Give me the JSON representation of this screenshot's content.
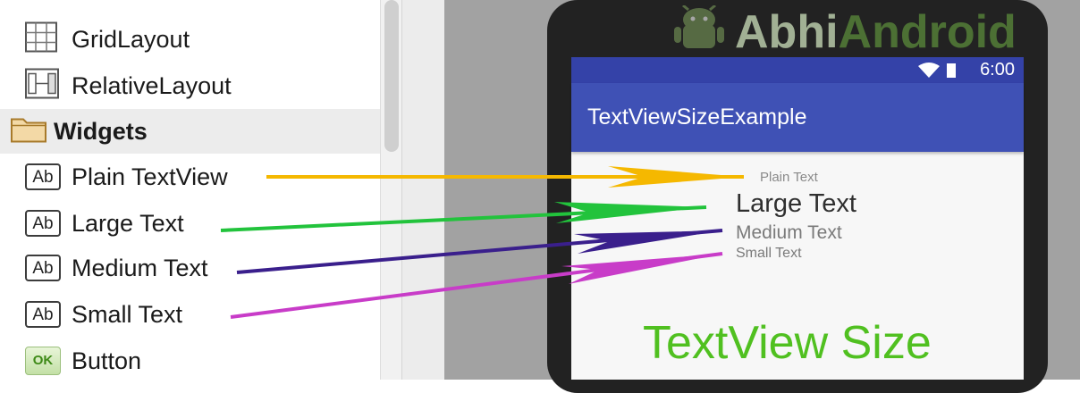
{
  "palette": {
    "items": [
      {
        "label": "GridLayout",
        "icon": "grid-layout-icon"
      },
      {
        "label": "RelativeLayout",
        "icon": "relative-layout-icon"
      },
      {
        "label": "Widgets",
        "icon": "folder-icon",
        "group": true
      },
      {
        "label": "Plain TextView",
        "icon": "ab-icon",
        "icon_text": "Ab"
      },
      {
        "label": "Large Text",
        "icon": "ab-icon",
        "icon_text": "Ab"
      },
      {
        "label": "Medium Text",
        "icon": "ab-icon",
        "icon_text": "Ab"
      },
      {
        "label": "Small Text",
        "icon": "ab-icon",
        "icon_text": "Ab"
      },
      {
        "label": "Button",
        "icon": "ok-icon",
        "icon_text": "OK"
      }
    ]
  },
  "watermark": {
    "text1": "Abhi",
    "text2": "Android"
  },
  "device": {
    "status_time": "6:00",
    "app_title": "TextViewSizeExample",
    "textviews": {
      "plain": "Plain Text",
      "large": "Large Text",
      "medium": "Medium Text",
      "small": "Small Text",
      "banner": "TextView Size"
    }
  },
  "colors": {
    "arrow_plain": "#f5b800",
    "arrow_large": "#22c33c",
    "arrow_medium": "#3a1f8c",
    "arrow_small": "#c83cc8",
    "appbar": "#3f51b5",
    "statusbar": "#3442a8",
    "banner_text": "#50c020"
  }
}
